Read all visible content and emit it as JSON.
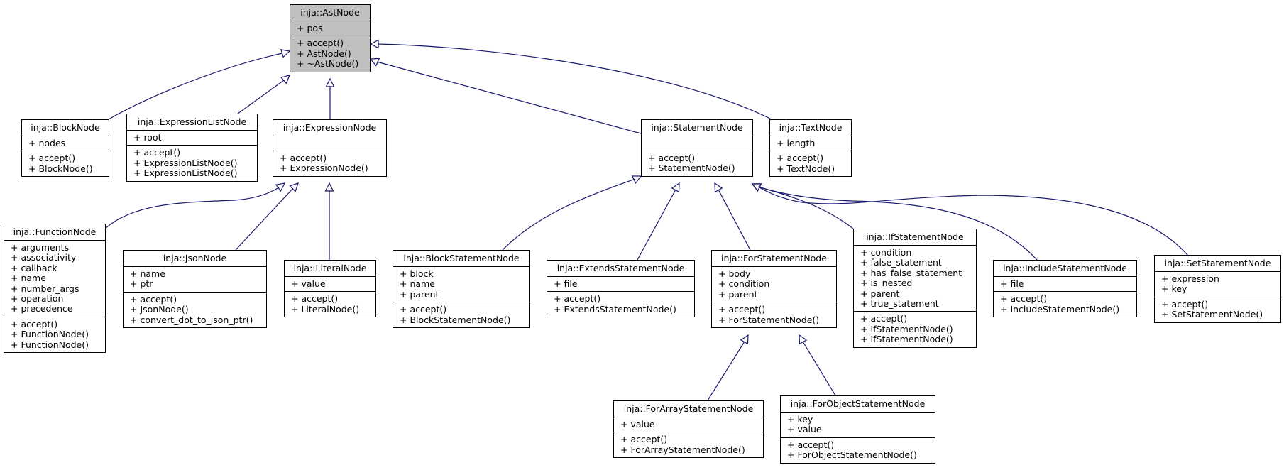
{
  "diagram": {
    "type": "class-inheritance-graph",
    "edge_color": "#191970",
    "base_fill": "#bfbfbf",
    "classes": {
      "AstNode": {
        "name": "inja::AstNode",
        "attributes": [
          "+ pos"
        ],
        "methods": [
          "+ accept()",
          "+ AstNode()",
          "+ ~AstNode()"
        ]
      },
      "BlockNode": {
        "name": "inja::BlockNode",
        "attributes": [
          "+ nodes"
        ],
        "methods": [
          "+ accept()",
          "+ BlockNode()"
        ]
      },
      "ExpressionListNode": {
        "name": "inja::ExpressionListNode",
        "attributes": [
          "+ root"
        ],
        "methods": [
          "+ accept()",
          "+ ExpressionListNode()",
          "+ ExpressionListNode()"
        ]
      },
      "ExpressionNode": {
        "name": "inja::ExpressionNode",
        "attributes": [],
        "methods": [
          "+ accept()",
          "+ ExpressionNode()"
        ]
      },
      "StatementNode": {
        "name": "inja::StatementNode",
        "attributes": [],
        "methods": [
          "+ accept()",
          "+ StatementNode()"
        ]
      },
      "TextNode": {
        "name": "inja::TextNode",
        "attributes": [
          "+ length"
        ],
        "methods": [
          "+ accept()",
          "+ TextNode()"
        ]
      },
      "FunctionNode": {
        "name": "inja::FunctionNode",
        "attributes": [
          "+ arguments",
          "+ associativity",
          "+ callback",
          "+ name",
          "+ number_args",
          "+ operation",
          "+ precedence"
        ],
        "methods": [
          "+ accept()",
          "+ FunctionNode()",
          "+ FunctionNode()"
        ]
      },
      "JsonNode": {
        "name": "inja::JsonNode",
        "attributes": [
          "+ name",
          "+ ptr"
        ],
        "methods": [
          "+ accept()",
          "+ JsonNode()",
          "+ convert_dot_to_json_ptr()"
        ]
      },
      "LiteralNode": {
        "name": "inja::LiteralNode",
        "attributes": [
          "+ value"
        ],
        "methods": [
          "+ accept()",
          "+ LiteralNode()"
        ]
      },
      "BlockStatementNode": {
        "name": "inja::BlockStatementNode",
        "attributes": [
          "+ block",
          "+ name",
          "+ parent"
        ],
        "methods": [
          "+ accept()",
          "+ BlockStatementNode()"
        ]
      },
      "ExtendsStatementNode": {
        "name": "inja::ExtendsStatementNode",
        "attributes": [
          "+ file"
        ],
        "methods": [
          "+ accept()",
          "+ ExtendsStatementNode()"
        ]
      },
      "ForStatementNode": {
        "name": "inja::ForStatementNode",
        "attributes": [
          "+ body",
          "+ condition",
          "+ parent"
        ],
        "methods": [
          "+ accept()",
          "+ ForStatementNode()"
        ]
      },
      "IfStatementNode": {
        "name": "inja::IfStatementNode",
        "attributes": [
          "+ condition",
          "+ false_statement",
          "+ has_false_statement",
          "+ is_nested",
          "+ parent",
          "+ true_statement"
        ],
        "methods": [
          "+ accept()",
          "+ IfStatementNode()",
          "+ IfStatementNode()"
        ]
      },
      "IncludeStatementNode": {
        "name": "inja::IncludeStatementNode",
        "attributes": [
          "+ file"
        ],
        "methods": [
          "+ accept()",
          "+ IncludeStatementNode()"
        ]
      },
      "SetStatementNode": {
        "name": "inja::SetStatementNode",
        "attributes": [
          "+ expression",
          "+ key"
        ],
        "methods": [
          "+ accept()",
          "+ SetStatementNode()"
        ]
      },
      "ForArrayStatementNode": {
        "name": "inja::ForArrayStatementNode",
        "attributes": [
          "+ value"
        ],
        "methods": [
          "+ accept()",
          "+ ForArrayStatementNode()"
        ]
      },
      "ForObjectStatementNode": {
        "name": "inja::ForObjectStatementNode",
        "attributes": [
          "+ key",
          "+ value"
        ],
        "methods": [
          "+ accept()",
          "+ ForObjectStatementNode()"
        ]
      }
    },
    "inheritance": [
      {
        "child": "BlockNode",
        "parent": "AstNode"
      },
      {
        "child": "ExpressionListNode",
        "parent": "AstNode"
      },
      {
        "child": "ExpressionNode",
        "parent": "AstNode"
      },
      {
        "child": "StatementNode",
        "parent": "AstNode"
      },
      {
        "child": "TextNode",
        "parent": "AstNode"
      },
      {
        "child": "FunctionNode",
        "parent": "ExpressionNode"
      },
      {
        "child": "JsonNode",
        "parent": "ExpressionNode"
      },
      {
        "child": "LiteralNode",
        "parent": "ExpressionNode"
      },
      {
        "child": "BlockStatementNode",
        "parent": "StatementNode"
      },
      {
        "child": "ExtendsStatementNode",
        "parent": "StatementNode"
      },
      {
        "child": "ForStatementNode",
        "parent": "StatementNode"
      },
      {
        "child": "IfStatementNode",
        "parent": "StatementNode"
      },
      {
        "child": "IncludeStatementNode",
        "parent": "StatementNode"
      },
      {
        "child": "SetStatementNode",
        "parent": "StatementNode"
      },
      {
        "child": "ForArrayStatementNode",
        "parent": "ForStatementNode"
      },
      {
        "child": "ForObjectStatementNode",
        "parent": "ForStatementNode"
      }
    ]
  }
}
